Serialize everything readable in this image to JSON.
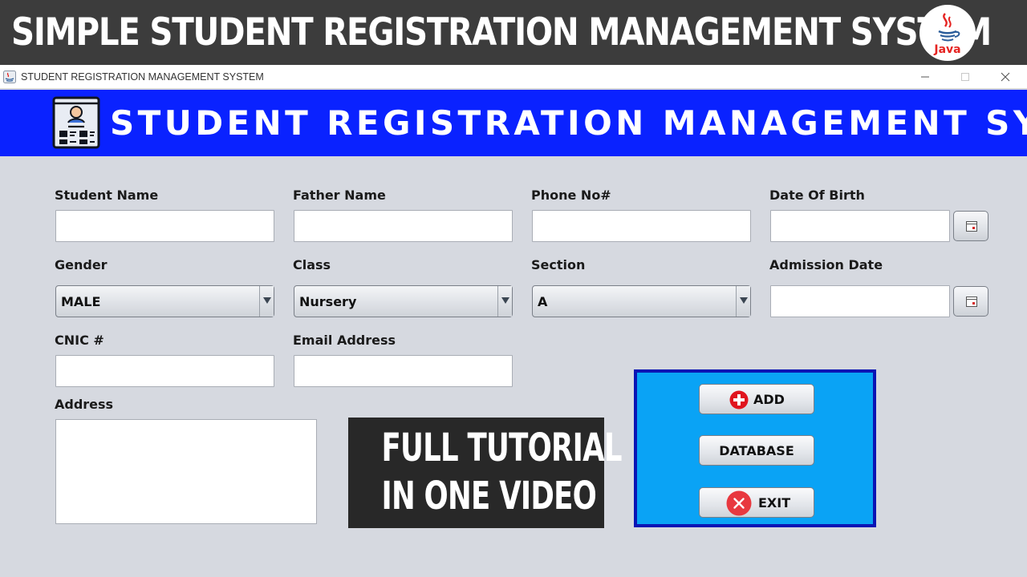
{
  "banner": {
    "title": "SIMPLE STUDENT REGISTRATION MANAGEMENT SYSTEM",
    "logo_text": "Java",
    "logo_icon": "java-cup-icon",
    "background": "#3c3c3c"
  },
  "window": {
    "title": "STUDENT REGISTRATION MANAGEMENT SYSTEM",
    "controls": [
      "minimize-icon",
      "maximize-icon",
      "close-icon"
    ]
  },
  "header": {
    "title": "STUDENT REGISTRATION MANAGEMENT SYSTEM",
    "icon": "student-id-card-icon",
    "background": "#0a22ff"
  },
  "form": {
    "student_name": {
      "label": "Student Name",
      "value": ""
    },
    "father_name": {
      "label": "Father Name",
      "value": ""
    },
    "phone": {
      "label": "Phone No#",
      "value": ""
    },
    "dob": {
      "label": "Date Of Birth",
      "value": "",
      "button_icon": "calendar-icon"
    },
    "gender": {
      "label": "Gender",
      "selected": "MALE"
    },
    "class": {
      "label": "Class",
      "selected": "Nursery"
    },
    "section": {
      "label": "Section",
      "selected": "A"
    },
    "admission_date": {
      "label": "Admission Date",
      "value": "",
      "button_icon": "calendar-icon"
    },
    "cnic": {
      "label": "CNIC #",
      "value": ""
    },
    "email": {
      "label": "Email Address",
      "value": ""
    },
    "address": {
      "label": "Address",
      "value": ""
    }
  },
  "tutorial": {
    "line1": "FULL TUTORIAL",
    "line2": "IN ONE VIDEO"
  },
  "actions": {
    "background": "#0aa3f5",
    "border": "#0a14b4",
    "add": {
      "label": "ADD",
      "icon": "plus-circle-icon"
    },
    "database": {
      "label": "DATABASE"
    },
    "exit": {
      "label": "EXIT",
      "icon": "close-circle-icon"
    }
  }
}
